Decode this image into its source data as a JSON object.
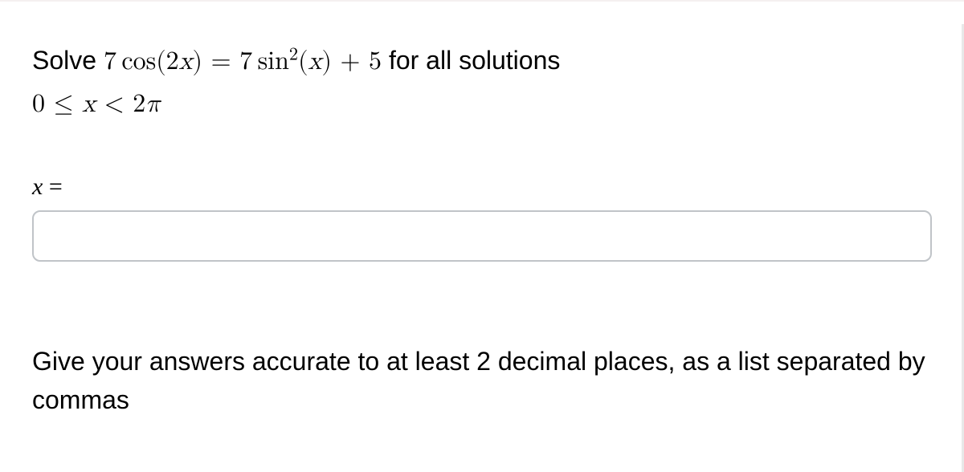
{
  "problem": {
    "solve_text": "Solve ",
    "equation_lhs_coef": "7",
    "equation_lhs_func": "cos",
    "equation_lhs_arg": "(2",
    "equation_lhs_var": "x",
    "equation_lhs_close": ")",
    "equals": " = ",
    "equation_rhs_coef": "7",
    "equation_rhs_func": "sin",
    "equation_rhs_exp": "2",
    "equation_rhs_open": "(",
    "equation_rhs_var": "x",
    "equation_rhs_close": ")",
    "equation_rhs_plus": " + 5",
    "for_all_text": " for all solutions ",
    "range_lower": "0",
    "range_leq": " ≤ ",
    "range_var": "x",
    "range_lt": " < ",
    "range_upper_coef": "2",
    "range_upper_pi": "π"
  },
  "answer": {
    "label_var": "x",
    "label_eq": " =",
    "value": ""
  },
  "instructions": {
    "text": "Give your answers accurate to at least 2 decimal places, as a list separated by commas"
  }
}
